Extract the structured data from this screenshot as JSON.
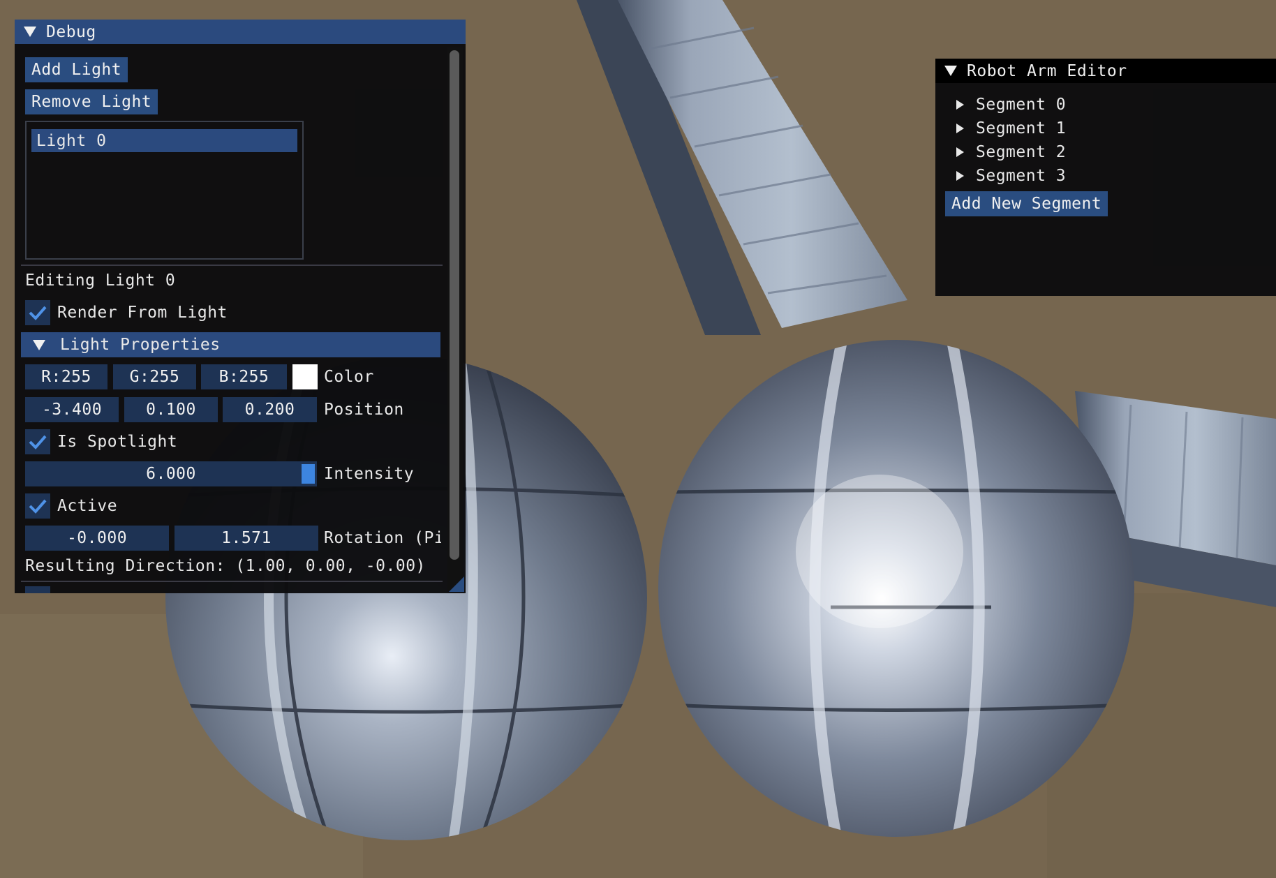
{
  "debug_window": {
    "title": "Debug",
    "add_light_label": "Add Light",
    "remove_light_label": "Remove Light",
    "light_list": [
      "Light 0"
    ],
    "editing_label": "Editing Light 0",
    "render_from_light": {
      "label": "Render From Light",
      "checked": true
    },
    "light_properties_header": "Light Properties",
    "color": {
      "r": "R:255",
      "g": "G:255",
      "b": "B:255",
      "swatch": "#ffffff",
      "label": "Color"
    },
    "position": {
      "x": "-3.400",
      "y": "0.100",
      "z": "0.200",
      "label": "Position"
    },
    "is_spotlight": {
      "label": "Is Spotlight",
      "checked": true
    },
    "intensity": {
      "value": "6.000",
      "label": "Intensity"
    },
    "active": {
      "label": "Active",
      "checked": true
    },
    "rotation": {
      "a": "-0.000",
      "b": "1.571",
      "label": "Rotation (Pi"
    },
    "resulting_direction": "Resulting Direction: (1.00, 0.00, -0.00)"
  },
  "robot_arm_window": {
    "title": "Robot Arm Editor",
    "segments": [
      "Segment 0",
      "Segment 1",
      "Segment 2",
      "Segment 3"
    ],
    "add_segment_label": "Add New Segment"
  },
  "colors": {
    "title_active": "#2b4a7e",
    "button": "#2a4d80",
    "frame": "#1e3354",
    "check": "#4f93e8",
    "window_bg": "#0c0c0e"
  }
}
